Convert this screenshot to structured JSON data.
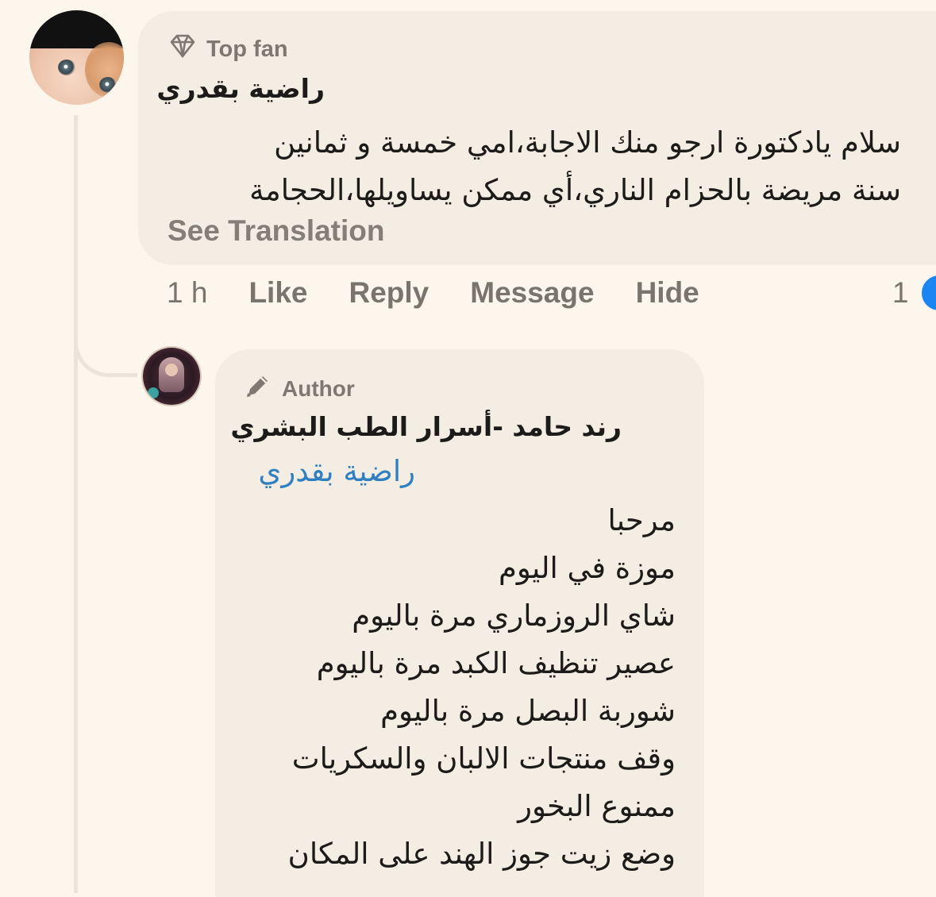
{
  "comment": {
    "badge_label": "Top fan",
    "badge_icon": "diamond-icon",
    "author": "راضية بقدري",
    "text_lines": [
      "سلام يادكتورة ارجو منك الاجابة،امي خمسة و ثمانين",
      "سنة مريضة بالحزام الناري،أي ممكن يساويلها،الحجامة"
    ],
    "see_translation": "See Translation",
    "timestamp": "1 h",
    "actions": {
      "like": "Like",
      "reply": "Reply",
      "message": "Message",
      "hide": "Hide"
    },
    "reaction_count": "1",
    "reaction_color": "#1b86f2"
  },
  "reply": {
    "badge_label": "Author",
    "badge_icon": "pencil-icon",
    "author": "رند حامد -أسرار الطب البشري",
    "mention": "راضية بقدري",
    "mention_color": "#2f7fc1",
    "lines": [
      "مرحبا",
      "موزة في اليوم",
      "شاي الروزماري مرة باليوم",
      "عصير تنظيف الكبد مرة باليوم",
      "شوربة البصل مرة باليوم",
      "وقف منتجات الالبان والسكريات",
      "ممنوع البخور",
      "وضع زيت جوز الهند على المكان"
    ]
  },
  "colors": {
    "background": "#fcf6ec",
    "bubble": "#f3ede3",
    "muted_text": "#7f7770"
  }
}
